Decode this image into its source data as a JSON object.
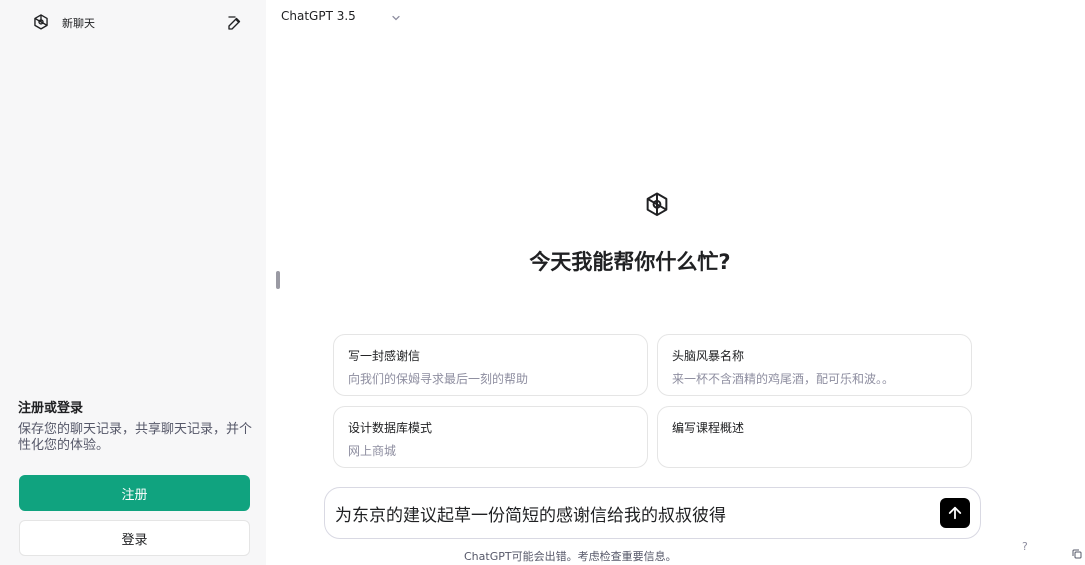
{
  "sidebar": {
    "new_chat_label": "新聊天",
    "signup": {
      "title": "注册或登录",
      "description": "保存您的聊天记录，共享聊天记录，并个性化您的体验。",
      "signup_button": "注册",
      "login_button": "登录"
    }
  },
  "header": {
    "model_label": "ChatGPT 3.5"
  },
  "main": {
    "headline": "今天我能帮你什么忙?",
    "suggestions": [
      {
        "title": "写一封感谢信",
        "subtitle": "向我们的保姆寻求最后一刻的帮助"
      },
      {
        "title": "头脑风暴名称",
        "subtitle": "来一杯不含酒精的鸡尾酒，配可乐和波。。"
      },
      {
        "title": "设计数据库模式",
        "subtitle": "网上商城"
      },
      {
        "title": "编写课程概述",
        "subtitle": ""
      }
    ],
    "composer_text": "为东京的建议起草一份简短的感谢信给我的叔叔彼得",
    "disclaimer": "ChatGPT可能会出错。考虑检查重要信息。",
    "help_label": "?"
  },
  "colors": {
    "accent": "#10a37f",
    "sidebar_bg": "#f7f7f8",
    "send_button": "#000000"
  },
  "icons": {
    "logo": "openai-logo-icon",
    "edit": "edit-pencil-icon",
    "chevron": "chevron-down-icon",
    "send": "arrow-up-icon"
  }
}
